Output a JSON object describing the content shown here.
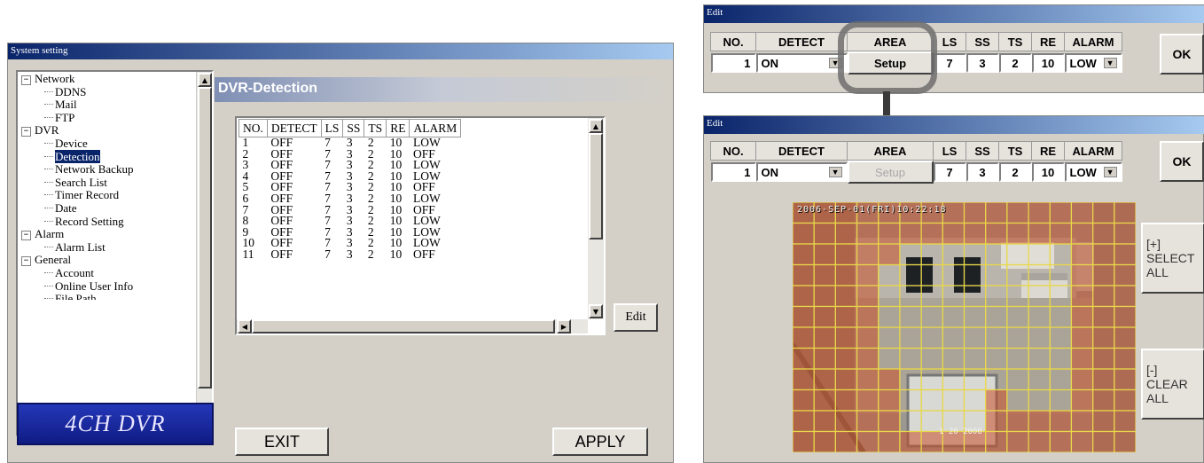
{
  "system_window": {
    "title": "System setting",
    "tree": [
      {
        "type": "root",
        "expander": "−",
        "label": "Network"
      },
      {
        "type": "child",
        "label": "DDNS"
      },
      {
        "type": "child",
        "label": "Mail"
      },
      {
        "type": "child",
        "label": "FTP"
      },
      {
        "type": "root",
        "expander": "−",
        "label": "DVR"
      },
      {
        "type": "child",
        "label": "Device"
      },
      {
        "type": "child",
        "label": "Detection",
        "selected": true
      },
      {
        "type": "child",
        "label": "Network Backup"
      },
      {
        "type": "child",
        "label": "Search List"
      },
      {
        "type": "child",
        "label": "Timer Record"
      },
      {
        "type": "child",
        "label": "Date"
      },
      {
        "type": "child",
        "label": "Record Setting"
      },
      {
        "type": "root",
        "expander": "−",
        "label": "Alarm"
      },
      {
        "type": "child",
        "label": "Alarm List"
      },
      {
        "type": "root",
        "expander": "−",
        "label": "General"
      },
      {
        "type": "child",
        "label": "Account"
      },
      {
        "type": "child",
        "label": "Online User Info"
      },
      {
        "type": "child",
        "label": "File Path",
        "cut": true
      }
    ],
    "logo": "4CH DVR",
    "section_title": "DVR-Detection",
    "columns": [
      "NO.",
      "DETECT",
      "LS",
      "SS",
      "TS",
      "RE",
      "ALARM"
    ],
    "rows": [
      [
        "1",
        "OFF",
        "7",
        "3",
        "2",
        "10",
        "LOW"
      ],
      [
        "2",
        "OFF",
        "7",
        "3",
        "2",
        "10",
        "OFF"
      ],
      [
        "3",
        "OFF",
        "7",
        "3",
        "2",
        "10",
        "LOW"
      ],
      [
        "4",
        "OFF",
        "7",
        "3",
        "2",
        "10",
        "LOW"
      ],
      [
        "5",
        "OFF",
        "7",
        "3",
        "2",
        "10",
        "OFF"
      ],
      [
        "6",
        "OFF",
        "7",
        "3",
        "2",
        "10",
        "LOW"
      ],
      [
        "7",
        "OFF",
        "7",
        "3",
        "2",
        "10",
        "OFF"
      ],
      [
        "8",
        "OFF",
        "7",
        "3",
        "2",
        "10",
        "LOW"
      ],
      [
        "9",
        "OFF",
        "7",
        "3",
        "2",
        "10",
        "LOW"
      ],
      [
        "10",
        "OFF",
        "7",
        "3",
        "2",
        "10",
        "LOW"
      ],
      [
        "11",
        "OFF",
        "7",
        "3",
        "2",
        "10",
        "OFF"
      ]
    ],
    "edit_label": "Edit",
    "exit_label": "EXIT",
    "apply_label": "APPLY"
  },
  "edit_top": {
    "title": "Edit",
    "columns": [
      "NO.",
      "DETECT",
      "AREA",
      "LS",
      "SS",
      "TS",
      "RE",
      "ALARM"
    ],
    "values": {
      "no": "1",
      "detect": "ON",
      "area": "Setup",
      "ls": "7",
      "ss": "3",
      "ts": "2",
      "re": "10",
      "alarm": "LOW"
    },
    "ok_label": "OK"
  },
  "edit_bottom": {
    "title": "Edit",
    "columns": [
      "NO.",
      "DETECT",
      "AREA",
      "LS",
      "SS",
      "TS",
      "RE",
      "ALARM"
    ],
    "values": {
      "no": "1",
      "detect": "ON",
      "area": "Setup",
      "ls": "7",
      "ss": "3",
      "ts": "2",
      "re": "10",
      "alarm": "LOW"
    },
    "ok_label": "OK",
    "camera_timestamp": "2006-SEP-01(FRI)10:22:18",
    "camera_label": "1 20 2006",
    "select_all": [
      "[+]",
      "SELECT",
      "ALL"
    ],
    "clear_all": [
      "[-]",
      "CLEAR",
      "ALL"
    ]
  },
  "colors": {
    "title_dark": "#0a246a",
    "title_light": "#a6caf0",
    "logo_blue": "#1b2a9e",
    "highlight_ring": "#7a7a7a",
    "grid_line": "#e8d84a",
    "grid_fill": "#c8502a"
  }
}
